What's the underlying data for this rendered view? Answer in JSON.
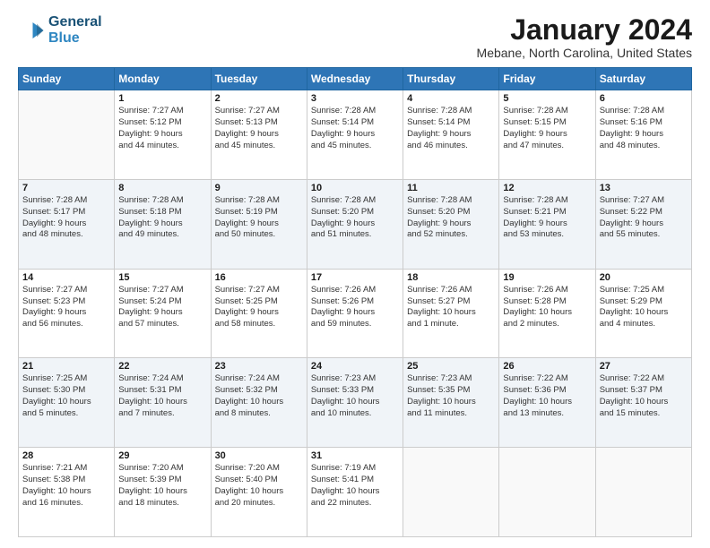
{
  "logo": {
    "line1": "General",
    "line2": "Blue"
  },
  "title": "January 2024",
  "subtitle": "Mebane, North Carolina, United States",
  "days_of_week": [
    "Sunday",
    "Monday",
    "Tuesday",
    "Wednesday",
    "Thursday",
    "Friday",
    "Saturday"
  ],
  "weeks": [
    [
      {
        "day": "",
        "info": ""
      },
      {
        "day": "1",
        "info": "Sunrise: 7:27 AM\nSunset: 5:12 PM\nDaylight: 9 hours\nand 44 minutes."
      },
      {
        "day": "2",
        "info": "Sunrise: 7:27 AM\nSunset: 5:13 PM\nDaylight: 9 hours\nand 45 minutes."
      },
      {
        "day": "3",
        "info": "Sunrise: 7:28 AM\nSunset: 5:14 PM\nDaylight: 9 hours\nand 45 minutes."
      },
      {
        "day": "4",
        "info": "Sunrise: 7:28 AM\nSunset: 5:14 PM\nDaylight: 9 hours\nand 46 minutes."
      },
      {
        "day": "5",
        "info": "Sunrise: 7:28 AM\nSunset: 5:15 PM\nDaylight: 9 hours\nand 47 minutes."
      },
      {
        "day": "6",
        "info": "Sunrise: 7:28 AM\nSunset: 5:16 PM\nDaylight: 9 hours\nand 48 minutes."
      }
    ],
    [
      {
        "day": "7",
        "info": "Sunrise: 7:28 AM\nSunset: 5:17 PM\nDaylight: 9 hours\nand 48 minutes."
      },
      {
        "day": "8",
        "info": "Sunrise: 7:28 AM\nSunset: 5:18 PM\nDaylight: 9 hours\nand 49 minutes."
      },
      {
        "day": "9",
        "info": "Sunrise: 7:28 AM\nSunset: 5:19 PM\nDaylight: 9 hours\nand 50 minutes."
      },
      {
        "day": "10",
        "info": "Sunrise: 7:28 AM\nSunset: 5:20 PM\nDaylight: 9 hours\nand 51 minutes."
      },
      {
        "day": "11",
        "info": "Sunrise: 7:28 AM\nSunset: 5:20 PM\nDaylight: 9 hours\nand 52 minutes."
      },
      {
        "day": "12",
        "info": "Sunrise: 7:28 AM\nSunset: 5:21 PM\nDaylight: 9 hours\nand 53 minutes."
      },
      {
        "day": "13",
        "info": "Sunrise: 7:27 AM\nSunset: 5:22 PM\nDaylight: 9 hours\nand 55 minutes."
      }
    ],
    [
      {
        "day": "14",
        "info": "Sunrise: 7:27 AM\nSunset: 5:23 PM\nDaylight: 9 hours\nand 56 minutes."
      },
      {
        "day": "15",
        "info": "Sunrise: 7:27 AM\nSunset: 5:24 PM\nDaylight: 9 hours\nand 57 minutes."
      },
      {
        "day": "16",
        "info": "Sunrise: 7:27 AM\nSunset: 5:25 PM\nDaylight: 9 hours\nand 58 minutes."
      },
      {
        "day": "17",
        "info": "Sunrise: 7:26 AM\nSunset: 5:26 PM\nDaylight: 9 hours\nand 59 minutes."
      },
      {
        "day": "18",
        "info": "Sunrise: 7:26 AM\nSunset: 5:27 PM\nDaylight: 10 hours\nand 1 minute."
      },
      {
        "day": "19",
        "info": "Sunrise: 7:26 AM\nSunset: 5:28 PM\nDaylight: 10 hours\nand 2 minutes."
      },
      {
        "day": "20",
        "info": "Sunrise: 7:25 AM\nSunset: 5:29 PM\nDaylight: 10 hours\nand 4 minutes."
      }
    ],
    [
      {
        "day": "21",
        "info": "Sunrise: 7:25 AM\nSunset: 5:30 PM\nDaylight: 10 hours\nand 5 minutes."
      },
      {
        "day": "22",
        "info": "Sunrise: 7:24 AM\nSunset: 5:31 PM\nDaylight: 10 hours\nand 7 minutes."
      },
      {
        "day": "23",
        "info": "Sunrise: 7:24 AM\nSunset: 5:32 PM\nDaylight: 10 hours\nand 8 minutes."
      },
      {
        "day": "24",
        "info": "Sunrise: 7:23 AM\nSunset: 5:33 PM\nDaylight: 10 hours\nand 10 minutes."
      },
      {
        "day": "25",
        "info": "Sunrise: 7:23 AM\nSunset: 5:35 PM\nDaylight: 10 hours\nand 11 minutes."
      },
      {
        "day": "26",
        "info": "Sunrise: 7:22 AM\nSunset: 5:36 PM\nDaylight: 10 hours\nand 13 minutes."
      },
      {
        "day": "27",
        "info": "Sunrise: 7:22 AM\nSunset: 5:37 PM\nDaylight: 10 hours\nand 15 minutes."
      }
    ],
    [
      {
        "day": "28",
        "info": "Sunrise: 7:21 AM\nSunset: 5:38 PM\nDaylight: 10 hours\nand 16 minutes."
      },
      {
        "day": "29",
        "info": "Sunrise: 7:20 AM\nSunset: 5:39 PM\nDaylight: 10 hours\nand 18 minutes."
      },
      {
        "day": "30",
        "info": "Sunrise: 7:20 AM\nSunset: 5:40 PM\nDaylight: 10 hours\nand 20 minutes."
      },
      {
        "day": "31",
        "info": "Sunrise: 7:19 AM\nSunset: 5:41 PM\nDaylight: 10 hours\nand 22 minutes."
      },
      {
        "day": "",
        "info": ""
      },
      {
        "day": "",
        "info": ""
      },
      {
        "day": "",
        "info": ""
      }
    ]
  ]
}
